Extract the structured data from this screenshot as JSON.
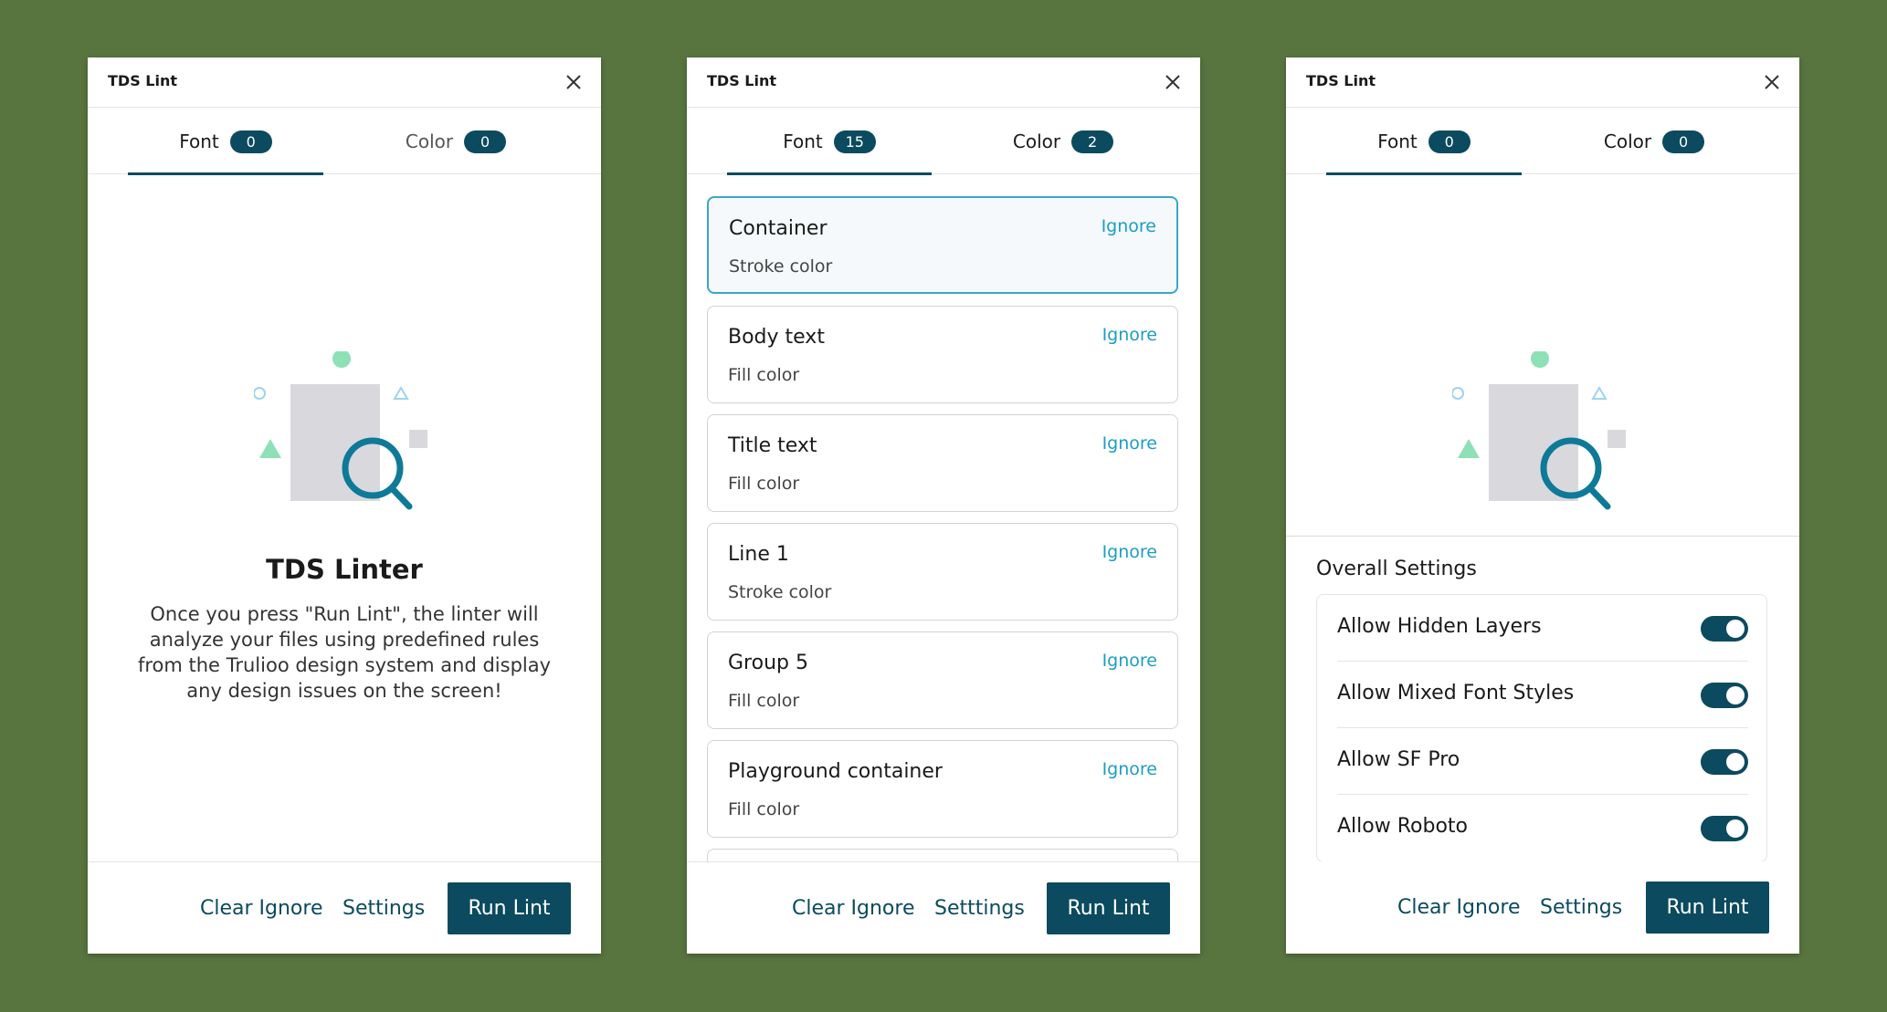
{
  "colors": {
    "background": "#58743f",
    "primary": "#0b4a5f",
    "accent_link": "#1c9dc2",
    "selected_border": "#3aa6c9",
    "illus_green": "#8ee0b6",
    "illus_blue": "#9ed4ea",
    "illus_gray": "#d9d9dd",
    "magnifier": "#0e7a98"
  },
  "panels": [
    {
      "title": "TDS Lint",
      "tabs": [
        {
          "label": "Font",
          "count": "0"
        },
        {
          "label": "Color",
          "count": "0"
        }
      ],
      "empty_title": "TDS Linter",
      "empty_body": "Once you press \"Run Lint\", the linter will analyze your files using predefined rules from the Trulioo design system and display any design issues on the screen!",
      "footer": {
        "clear": "Clear Ignore",
        "settings": "Settings",
        "run": "Run Lint"
      }
    },
    {
      "title": "TDS Lint",
      "tabs": [
        {
          "label": "Font",
          "count": "15"
        },
        {
          "label": "Color",
          "count": "2"
        }
      ],
      "issues": [
        {
          "name": "Container",
          "desc": "Stroke color",
          "action": "Ignore"
        },
        {
          "name": "Body text",
          "desc": "Fill color",
          "action": "Ignore"
        },
        {
          "name": "Title text",
          "desc": "Fill color",
          "action": "Ignore"
        },
        {
          "name": "Line 1",
          "desc": "Stroke color",
          "action": "Ignore"
        },
        {
          "name": "Group 5",
          "desc": "Fill color",
          "action": "Ignore"
        },
        {
          "name": "Playground container",
          "desc": "Fill color",
          "action": "Ignore"
        }
      ],
      "footer": {
        "clear": "Clear Ignore",
        "settings": "Setttings",
        "run": "Run Lint"
      }
    },
    {
      "title": "TDS Lint",
      "tabs": [
        {
          "label": "Font",
          "count": "0"
        },
        {
          "label": "Color",
          "count": "0"
        }
      ],
      "settings_title": "Overall Settings",
      "settings": [
        {
          "label": "Allow Hidden Layers",
          "enabled": true
        },
        {
          "label": "Allow Mixed Font Styles",
          "enabled": true
        },
        {
          "label": "Allow SF Pro",
          "enabled": true
        },
        {
          "label": "Allow Roboto",
          "enabled": true
        }
      ],
      "footer": {
        "clear": "Clear Ignore",
        "settings": "Settings",
        "run": "Run Lint"
      }
    }
  ]
}
